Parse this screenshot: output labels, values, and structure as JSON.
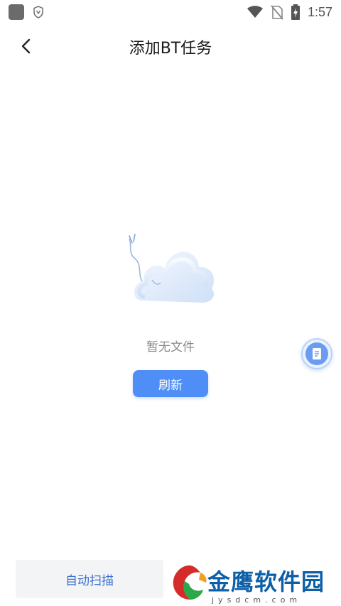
{
  "status_bar": {
    "time": "1:57",
    "icons": [
      "app-icon",
      "shield-icon",
      "wifi-icon",
      "no-sim-icon",
      "battery-charging-icon"
    ]
  },
  "header": {
    "title": "添加BT任务",
    "back_icon": "chevron-left-icon"
  },
  "empty_state": {
    "illustration": "cloud-icon",
    "message": "暂无文件",
    "refresh_label": "刷新"
  },
  "floating_button": {
    "icon": "document-icon"
  },
  "bottom_bar": {
    "auto_scan_label": "自动扫描"
  },
  "watermark": {
    "text": "金鹰软件园",
    "subtext": "jysdcm.com"
  },
  "colors": {
    "primary": "#4f8ef7",
    "scan_text": "#3d6fcf",
    "watermark": "#0d5fa8"
  }
}
